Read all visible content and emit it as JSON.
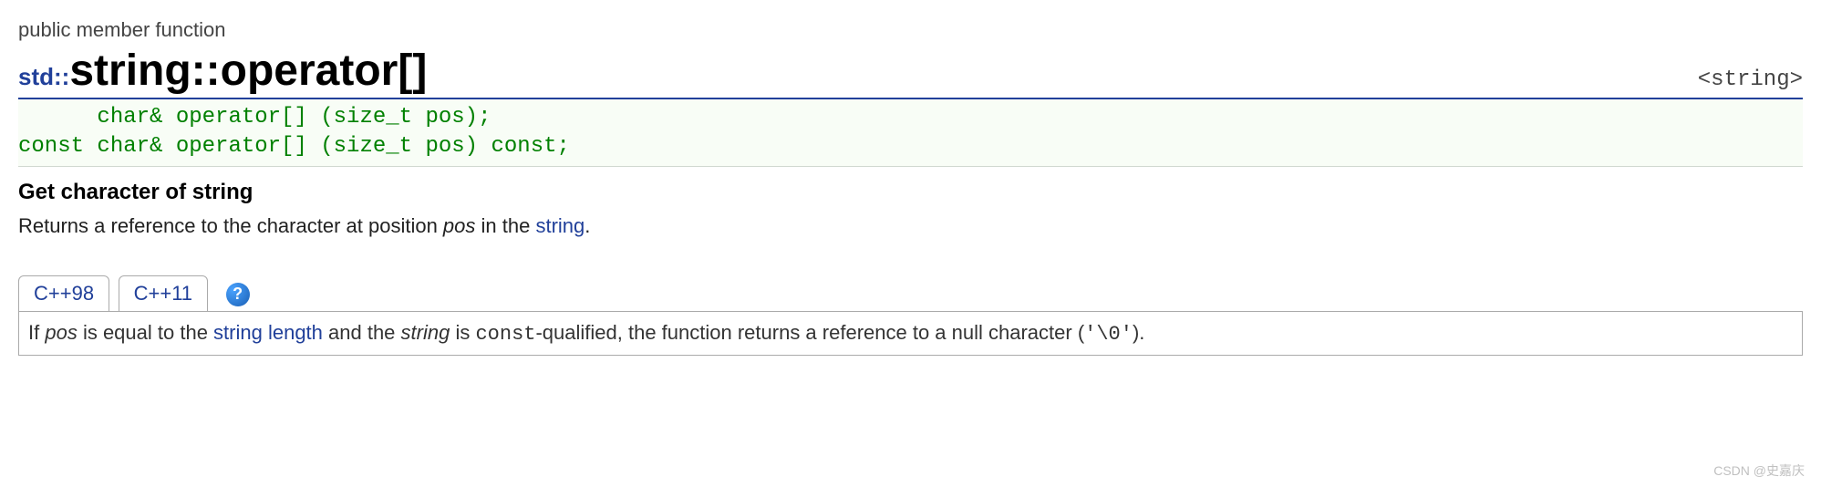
{
  "category": "public member function",
  "title": {
    "namespace": "std::",
    "class": "string",
    "sep": "::",
    "member": "operator[]"
  },
  "header_file": "<string>",
  "prototypes": [
    "      char& operator[] (size_t pos);",
    "const char& operator[] (size_t pos) const;"
  ],
  "section_heading": "Get character of string",
  "description": {
    "pre": "Returns a reference to the character at position ",
    "param": "pos",
    "mid": " in the ",
    "link": "string",
    "post": "."
  },
  "tabs": [
    "C++98",
    "C++11"
  ],
  "help_symbol": "?",
  "tab_content": {
    "t1": "If ",
    "param1": "pos",
    "t2": " is equal to the ",
    "link": "string length",
    "t3": " and the ",
    "param2": "string",
    "t4": " is ",
    "code1": "const",
    "t5": "-qualified, the function returns a reference to a null character (",
    "code2": "'\\0'",
    "t6": ")."
  },
  "watermark": "CSDN @史嘉庆"
}
